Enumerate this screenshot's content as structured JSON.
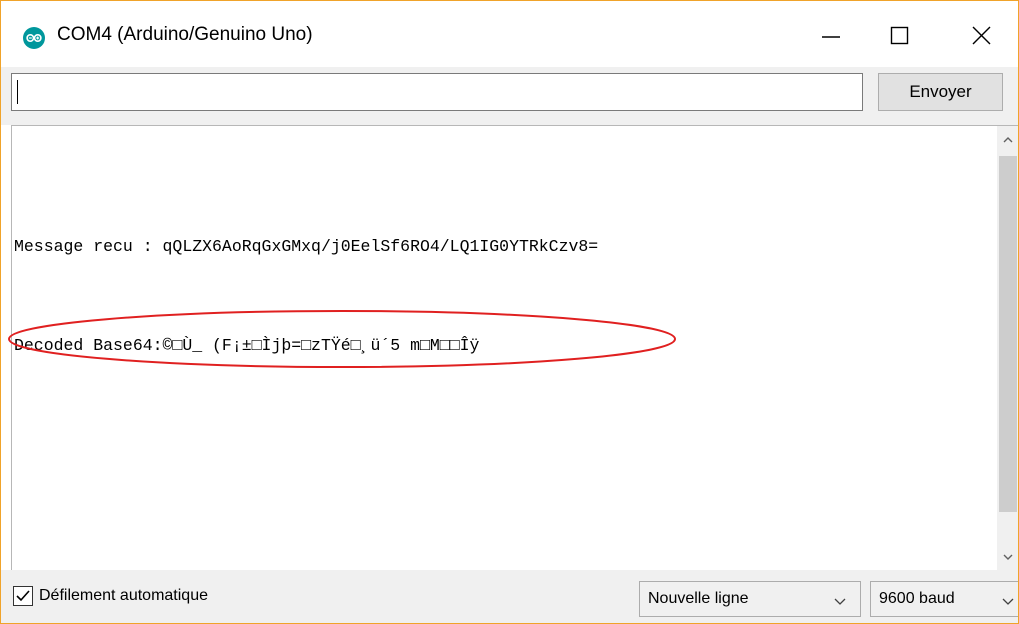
{
  "window": {
    "title": "COM4 (Arduino/Genuino Uno)",
    "icon": "arduino-logo-icon",
    "controls": [
      "minimize-icon",
      "maximize-icon",
      "close-icon"
    ]
  },
  "send": {
    "input_value": "",
    "button_label": "Envoyer"
  },
  "output": {
    "lines": [
      "Message recu : qQLZX6AoRqGxGMxq/j0EelSf6RO4/LQ1IG0YTRkCzv8=",
      "Decoded Base64:©□Ù_ (F¡±□Ìjþ=□zTŸé□¸ü´5 m□M□□Îÿ"
    ],
    "annotation_color": "#e02020"
  },
  "footer": {
    "autoscroll_label": "Défilement automatique",
    "autoscroll_checked": true,
    "line_ending": "Nouvelle ligne",
    "baud_rate": "9600 baud"
  },
  "colors": {
    "window_border": "#f0a32a",
    "arduino_teal": "#00979c"
  }
}
